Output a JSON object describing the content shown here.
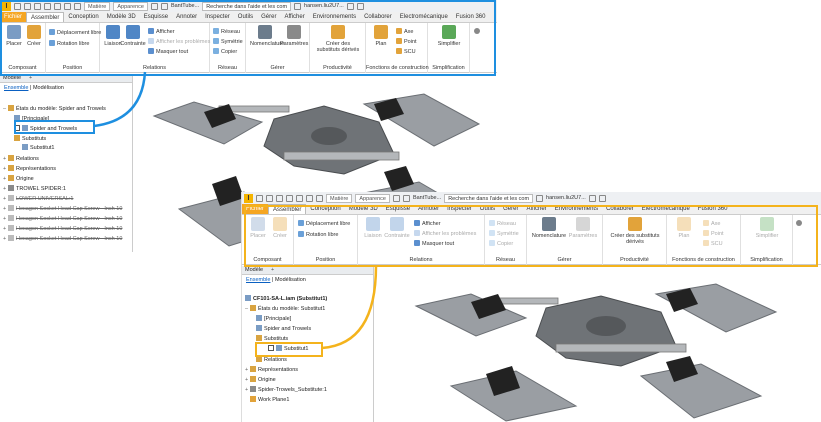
{
  "window1": {
    "title": "BantTube...",
    "search": "Recherche dans l'aide et les com",
    "user": "hansen.liu2U7...",
    "material": "Matière",
    "appearance": "Apparence",
    "tabs": [
      "Fichier",
      "Assembler",
      "Conception",
      "Modèle 3D",
      "Esquisse",
      "Annoter",
      "Inspecter",
      "Outils",
      "Gérer",
      "Afficher",
      "Environnements",
      "Collaborer",
      "Electromécanique",
      "Fusion 360"
    ],
    "ribbon": {
      "composant": {
        "title": "Composant",
        "placer": "Placer",
        "creer": "Créer"
      },
      "position": {
        "title": "Position",
        "deplacement": "Déplacement libre",
        "rotation": "Rotation libre"
      },
      "relations": {
        "title": "Relations",
        "liaison": "Liaison",
        "contrainte": "Contrainte",
        "afficher": "Afficher",
        "afficher_problemes": "Afficher les problèmes",
        "masquer": "Masquer tout"
      },
      "reseau": {
        "title": "Réseau",
        "reseau": "Réseau",
        "symetrie": "Symétrie",
        "copier": "Copier"
      },
      "gerer": {
        "title": "Gérer",
        "nomenclature": "Nomenclature",
        "parametres": "Paramètres"
      },
      "productivite": {
        "title": "Productivité",
        "substituts": "Créer des substituts dérivés"
      },
      "construction": {
        "title": "Fonctions de construction",
        "plan": "Plan",
        "axe": "Axe",
        "point": "Point",
        "scu": "SCU"
      },
      "simplification": {
        "title": "Simplification",
        "simplifier": "Simplifier"
      }
    },
    "browser": {
      "header": "Modèle",
      "tab_ensemble": "Ensemble",
      "tab_modelisation": "Modélisation",
      "nodes": [
        "États du modèle: Spider and Trowels",
        "[Principale]",
        "Spider and Trowels",
        "Substituts",
        "Substitut1",
        "Relations",
        "Représentations",
        "Origine",
        "TROWEL SPIDER:1",
        "LOWER UNIVERSAL:1",
        "Hexagon Socket Head Cap Screw - Inch 10",
        "Hexagon Socket Head Cap Screw - Inch 10",
        "Hexagon Socket Head Cap Screw - Inch 10",
        "Hexagon Socket Head Cap Screw - Inch 10"
      ]
    }
  },
  "window2": {
    "title": "BantTube...",
    "search": "Recherche dans l'aide et les com",
    "user": "hansen.liu2U7...",
    "material": "Matière",
    "appearance": "Apparence",
    "tabs": [
      "Fichier",
      "Assembler",
      "Conception",
      "Modèle 3D",
      "Esquisse",
      "Annoter",
      "Inspecter",
      "Outils",
      "Gérer",
      "Afficher",
      "Environnements",
      "Collaborer",
      "Electromécanique",
      "Fusion 360"
    ],
    "ribbon": {
      "composant": {
        "title": "Composant",
        "placer": "Placer",
        "creer": "Créer"
      },
      "position": {
        "title": "Position",
        "deplacement": "Déplacement libre",
        "rotation": "Rotation libre"
      },
      "relations": {
        "title": "Relations",
        "liaison": "Liaison",
        "contrainte": "Contrainte",
        "afficher": "Afficher",
        "afficher_problemes": "Afficher les problèmes",
        "masquer": "Masquer tout"
      },
      "reseau": {
        "title": "Réseau",
        "reseau": "Réseau",
        "symetrie": "Symétrie",
        "copier": "Copier"
      },
      "gerer": {
        "title": "Gérer",
        "nomenclature": "Nomenclature",
        "parametres": "Paramètres"
      },
      "productivite": {
        "title": "Productivité",
        "substituts": "Créer des substituts dérivés"
      },
      "construction": {
        "title": "Fonctions de construction",
        "plan": "Plan",
        "axe": "Axe",
        "point": "Point",
        "scu": "SCU"
      },
      "simplification": {
        "title": "Simplification",
        "simplifier": "Simplifier"
      }
    },
    "browser": {
      "header": "Modèle",
      "tab_ensemble": "Ensemble",
      "tab_modelisation": "Modélisation",
      "root": "CF101-SA-L.iam (Substitut1)",
      "nodes": [
        "États du modèle: Substitut1",
        "[Principale]",
        "Spider and Trowels",
        "Substituts",
        "Substitut1",
        "Relations",
        "Représentations",
        "Origine",
        "Spider-Trowels_Substitute:1",
        "Work Plane1"
      ]
    }
  },
  "colors": {
    "highlight_blue": "#1e8fe0",
    "highlight_orange": "#f4b31c",
    "file_tab": "#f5a623"
  }
}
